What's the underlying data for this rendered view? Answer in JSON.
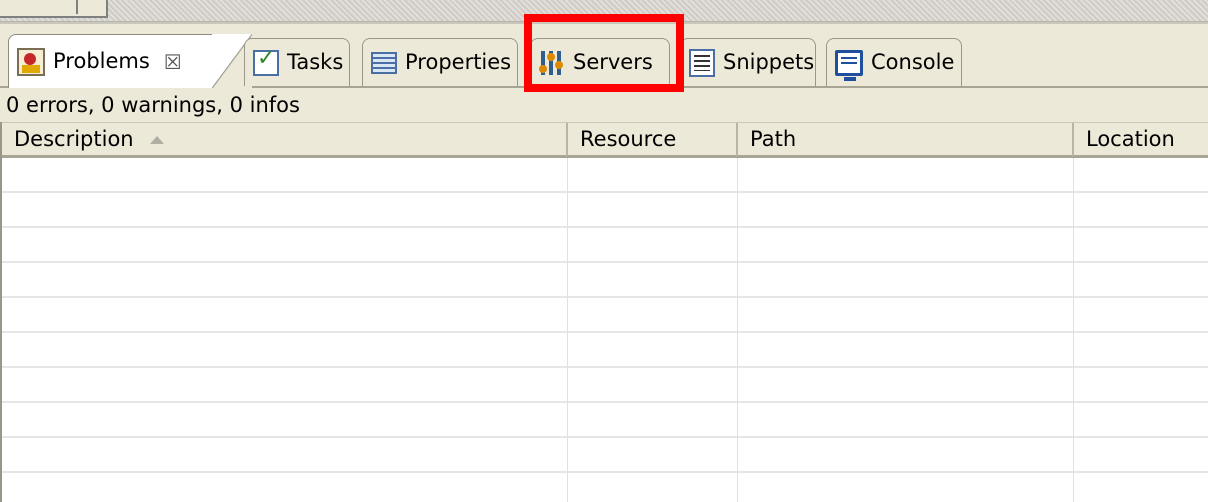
{
  "tabs": [
    {
      "label": "Problems",
      "icon": "problems-icon",
      "active": true,
      "closable": true
    },
    {
      "label": "Tasks",
      "icon": "tasks-icon"
    },
    {
      "label": "Properties",
      "icon": "properties-icon"
    },
    {
      "label": "Servers",
      "icon": "servers-icon",
      "highlighted": true
    },
    {
      "label": "Snippets",
      "icon": "snippets-icon"
    },
    {
      "label": "Console",
      "icon": "console-icon"
    }
  ],
  "close_glyph": "☒",
  "status_text": "0 errors, 0 warnings, 0 infos",
  "table": {
    "columns": [
      "Description",
      "Resource",
      "Path",
      "Location"
    ],
    "sort_column": "Description",
    "sort_direction": "ascending",
    "rows": []
  },
  "colors": {
    "highlight": "#ff0000",
    "panel_bg": "#ece9d8"
  }
}
